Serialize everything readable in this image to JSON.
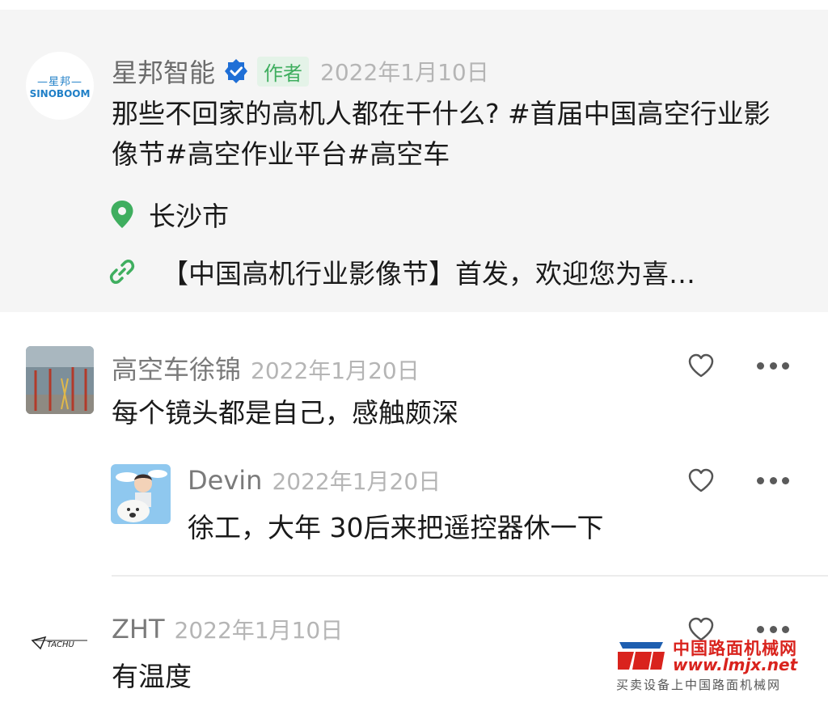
{
  "post": {
    "logo_cn": "—星邦—",
    "logo_en": "SINOBOOM",
    "author": "星邦智能",
    "verified_icon": "verified-check-icon",
    "author_badge": "作者",
    "date": "2022年1月10日",
    "body": "那些不回家的高机人都在干什么? #首届中国高空行业影像节#高空作业平台#高空车",
    "location": "长沙市",
    "link_text": "【中国高机行业影像节】首发，欢迎您为喜…",
    "accent_green": "#3fae5f"
  },
  "comments": [
    {
      "name": "高空车徐锦",
      "date": "2022年1月20日",
      "text": "每个镜头都是自己，感触颇深"
    },
    {
      "name": "Devin",
      "date": "2022年1月20日",
      "text": "徐工，大年 30后来把遥控器休一下",
      "is_reply": true
    },
    {
      "name": "ZHT",
      "date": "2022年1月10日",
      "text": "有温度",
      "avatar_text": "TACHU"
    }
  ],
  "watermark": {
    "title": "中国路面机械网",
    "url": "www.lmjx.net",
    "tagline": "买卖设备上中国路面机械网"
  }
}
